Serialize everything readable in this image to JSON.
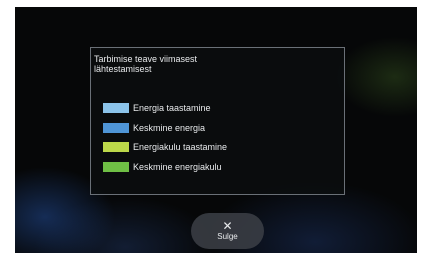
{
  "dialog": {
    "title_line1": "Tarbimise teave viimasest",
    "title_line2": "lähtestamisest"
  },
  "legend": {
    "items": [
      {
        "label": "Energia taastamine",
        "color": "#8cc4ea"
      },
      {
        "label": "Keskmine energia",
        "color": "#4f95d6"
      },
      {
        "label": "Energiakulu taastamine",
        "color": "#bcd84a"
      },
      {
        "label": "Keskmine energiakulu",
        "color": "#6fbf45"
      }
    ]
  },
  "footer": {
    "close_icon": "close-icon",
    "close_label": "Sulge"
  }
}
